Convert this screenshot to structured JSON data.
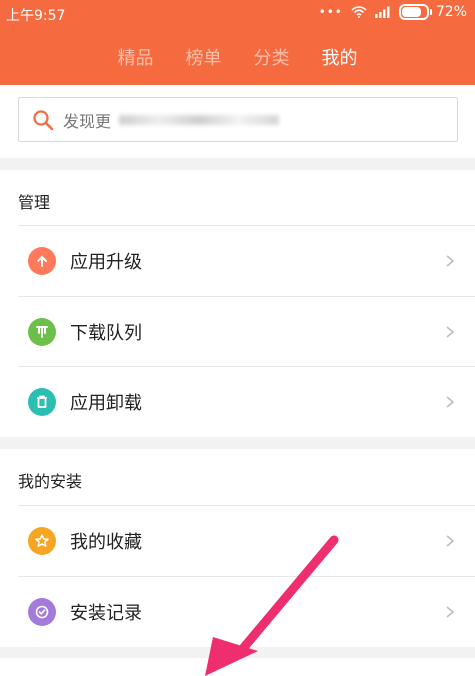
{
  "status": {
    "time": "上午9:57",
    "battery": "72%",
    "battery_level": 0.72
  },
  "tabs": [
    {
      "label": "精品",
      "active": false
    },
    {
      "label": "榜单",
      "active": false
    },
    {
      "label": "分类",
      "active": false
    },
    {
      "label": "我的",
      "active": true
    }
  ],
  "search": {
    "placeholder": "发现更"
  },
  "sections": {
    "manage": {
      "title": "管理",
      "items": [
        {
          "label": "应用升级",
          "icon": "up-arrow-icon",
          "color": "#ff7a5c"
        },
        {
          "label": "下载队列",
          "icon": "download-queue-icon",
          "color": "#6cc04a"
        },
        {
          "label": "应用卸载",
          "icon": "trash-icon",
          "color": "#2bbfb1"
        }
      ]
    },
    "installs": {
      "title": "我的安装",
      "items": [
        {
          "label": "我的收藏",
          "icon": "star-icon",
          "color": "#f6a623"
        },
        {
          "label": "安装记录",
          "icon": "check-circle-icon",
          "color": "#a47bdb"
        }
      ]
    }
  },
  "colors": {
    "header": "#f56b3f",
    "arrow": "#ee2e6f"
  }
}
